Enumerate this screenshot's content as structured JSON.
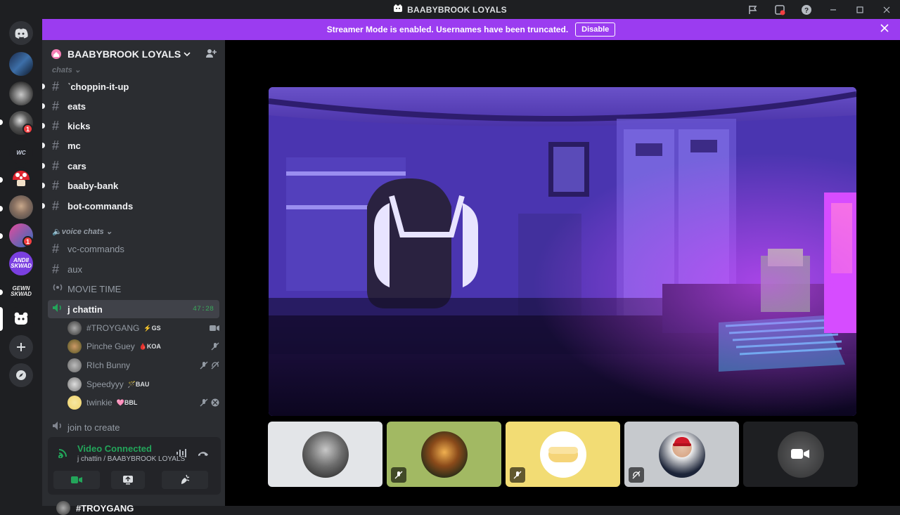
{
  "window": {
    "title": "BAABYBROOK LOYALS"
  },
  "streamer_banner": {
    "text": "Streamer Mode is enabled. Usernames have been truncated.",
    "button": "Disable"
  },
  "server": {
    "name": "BAABYBROOK LOYALS"
  },
  "categories": {
    "chats": "chats",
    "voice": "voice chats"
  },
  "text_channels": [
    {
      "name": "˺choppin-it-up"
    },
    {
      "name": "eats"
    },
    {
      "name": "kicks"
    },
    {
      "name": "mc"
    },
    {
      "name": "cars"
    },
    {
      "name": "baaby-bank"
    },
    {
      "name": "bot-commands"
    }
  ],
  "voice_section": {
    "vc_commands": "vc-commands",
    "aux": "aux",
    "movie_time": "MOVIE TIME",
    "active_channel": "j chattin",
    "timer": "47:28",
    "join_to_create": "join to create"
  },
  "voice_users": [
    {
      "name": "#TROYGANG",
      "tag": "⚡GS"
    },
    {
      "name": "Pinche Guey",
      "tag": "🩸KOA"
    },
    {
      "name": "RIch Bunny",
      "tag": ""
    },
    {
      "name": "Speedyyy",
      "tag": "🪄BAU"
    },
    {
      "name": "twinkie",
      "tag": "🩷BBL"
    }
  ],
  "voice_panel": {
    "status": "Video Connected",
    "sub": "j chattin / BAABYBROOK LOYALS"
  },
  "guild_badges": {
    "g3": "1",
    "g8": "1"
  },
  "footer_peek": "#TROYGANG",
  "colors": {
    "accent": "#9b3cf0",
    "online": "#23a55a",
    "blurple": "#5865f2"
  }
}
